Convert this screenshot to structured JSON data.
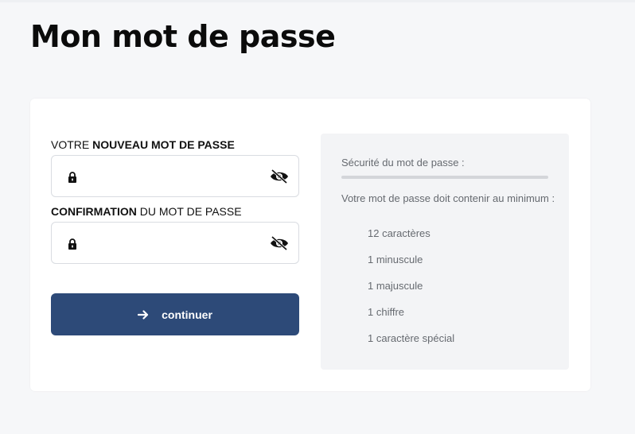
{
  "page": {
    "title": "Mon mot de passe"
  },
  "form": {
    "new_password": {
      "label_prefix": "VOTRE ",
      "label_bold": "NOUVEAU MOT DE PASSE",
      "value": "",
      "placeholder": ""
    },
    "confirm_password": {
      "label_bold": "CONFIRMATION",
      "label_suffix": " DU MOT DE PASSE",
      "value": "",
      "placeholder": ""
    },
    "submit_label": "continuer"
  },
  "rules": {
    "strength_label": "Sécurité du mot de passe :",
    "strength_level": 0,
    "intro": "Votre mot de passe doit contenir au minimum :",
    "items": [
      "12 caractères",
      "1 minuscule",
      "1 majuscule",
      "1 chiffre",
      "1 caractère spécial"
    ]
  },
  "icons": {
    "lock": "lock-icon",
    "eye": "eye-slash-icon",
    "arrow": "arrow-right-icon"
  },
  "colors": {
    "primary_button": "#2d4a78",
    "muted_text": "#666a70",
    "page_background": "#f6f7f9"
  }
}
